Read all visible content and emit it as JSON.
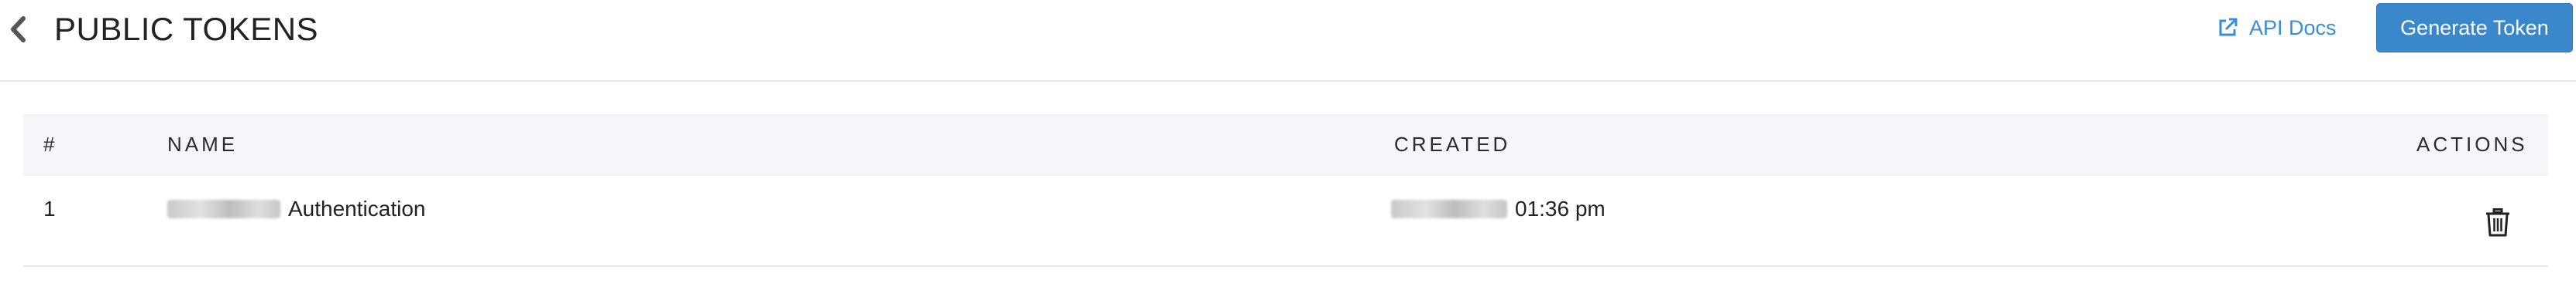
{
  "header": {
    "title": "PUBLIC TOKENS",
    "api_docs_label": "API Docs",
    "generate_label": "Generate Token"
  },
  "table": {
    "columns": [
      "#",
      "NAME",
      "CREATED",
      "ACTIONS"
    ],
    "rows": [
      {
        "index": "1",
        "name_suffix": "Authentication",
        "created_time": "01:36 pm"
      }
    ]
  },
  "colors": {
    "accent": "#3b87cc",
    "link": "#3a8dd6",
    "header_bg": "#f5f6fa"
  },
  "icons": [
    "chevron-left-icon",
    "external-link-icon",
    "trash-icon"
  ]
}
